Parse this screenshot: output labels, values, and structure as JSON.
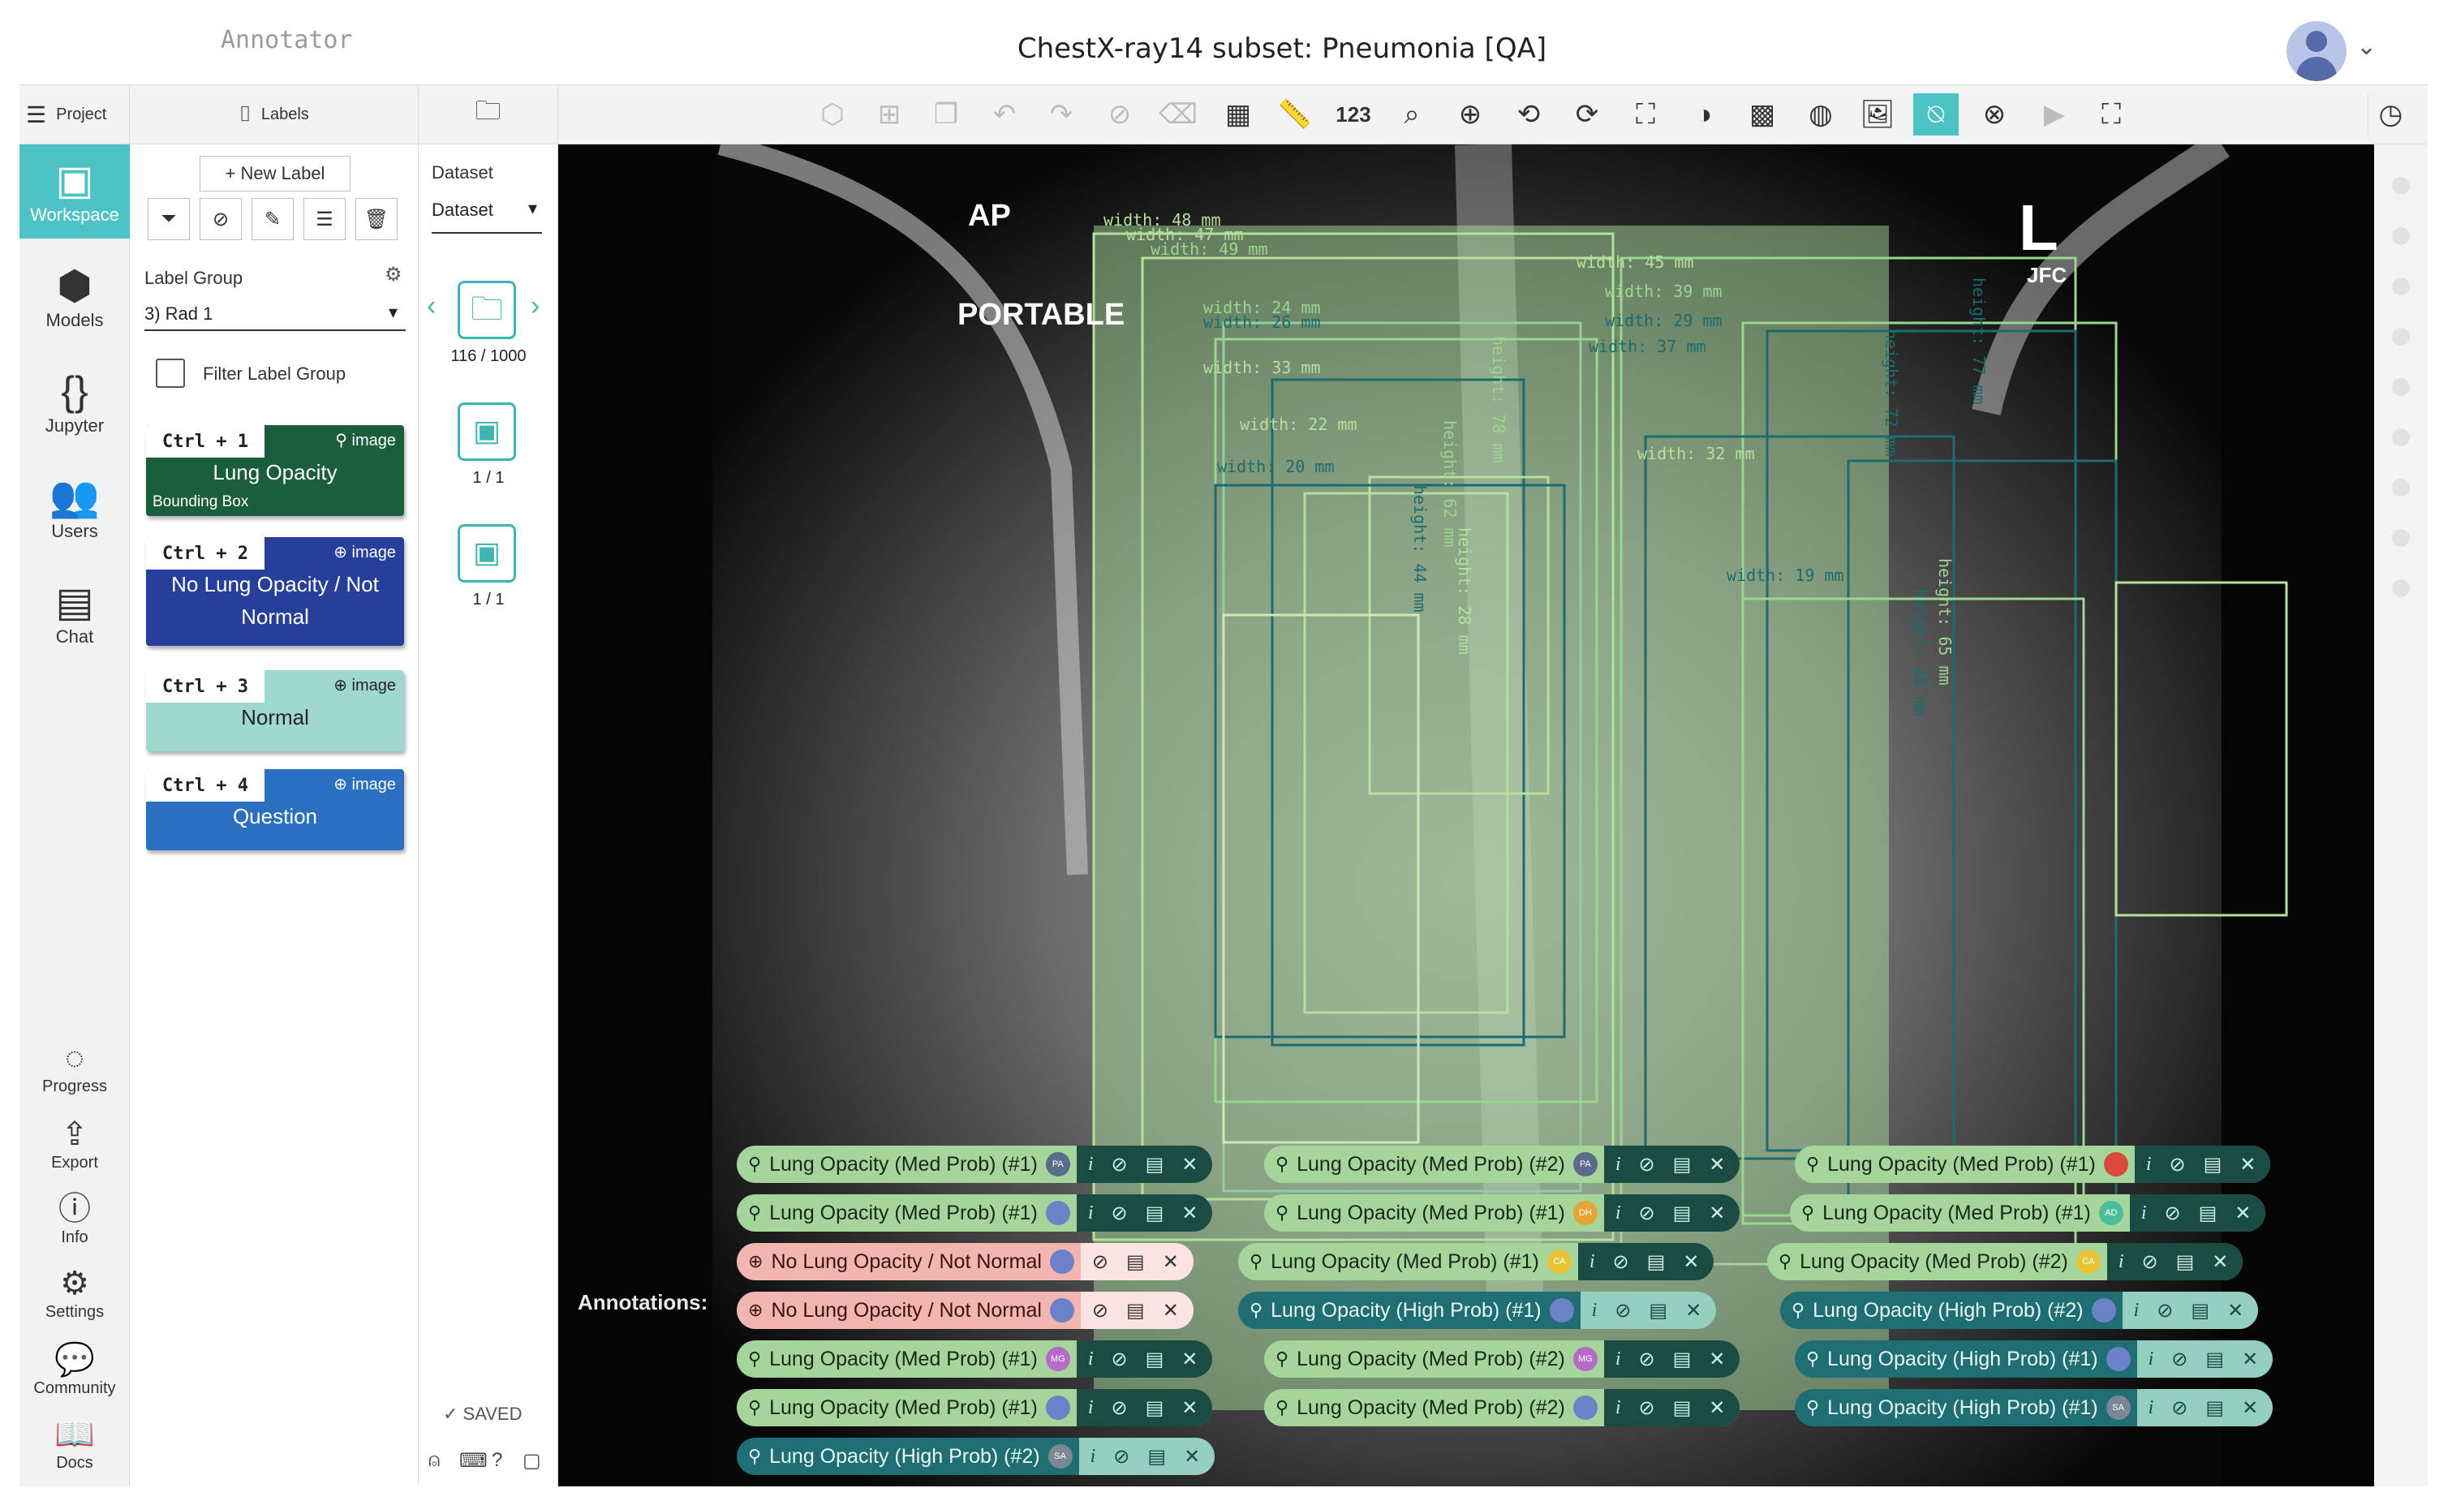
{
  "app": {
    "name": "Annotator",
    "title": "ChestX-ray14 subset: Pneumonia [QA]"
  },
  "toolbar": {
    "project_label": "Project",
    "labels_label": "Labels",
    "zoom_text": "123"
  },
  "nav": {
    "items": [
      {
        "label": "Workspace",
        "icon": "image-icon"
      },
      {
        "label": "Models",
        "icon": "cube-icon"
      },
      {
        "label": "Jupyter",
        "icon": "braces-icon"
      },
      {
        "label": "Users",
        "icon": "users-icon"
      },
      {
        "label": "Chat",
        "icon": "chat-icon"
      }
    ],
    "bottom": [
      {
        "label": "Progress",
        "icon": "progress-icon"
      },
      {
        "label": "Export",
        "icon": "export-icon"
      },
      {
        "label": "Info",
        "icon": "info-icon"
      },
      {
        "label": "Settings",
        "icon": "gear-icon"
      },
      {
        "label": "Community",
        "icon": "community-icon"
      },
      {
        "label": "Docs",
        "icon": "book-icon"
      }
    ]
  },
  "labels_panel": {
    "new_label": "+ New Label",
    "group_heading": "Label Group",
    "group_value": "3) Rad 1",
    "filter_label": "Filter Label Group",
    "cards": [
      {
        "key": "Ctrl + 1",
        "type": "image",
        "name": "Lung Opacity",
        "sub": "Bounding Box",
        "color": "#1b5e3c"
      },
      {
        "key": "Ctrl + 2",
        "type": "image",
        "name": "No Lung Opacity / Not Normal",
        "sub": "",
        "color": "#273f9b"
      },
      {
        "key": "Ctrl + 3",
        "type": "image",
        "name": "Normal",
        "sub": "",
        "color": "#9fd8cf"
      },
      {
        "key": "Ctrl + 4",
        "type": "image",
        "name": "Question",
        "sub": "",
        "color": "#2a6fc0"
      }
    ]
  },
  "dataset_panel": {
    "heading": "Dataset",
    "select_value": "Dataset",
    "counters": [
      "116 / 1000",
      "1 / 1",
      "1 / 1"
    ],
    "saved": "✓ SAVED"
  },
  "image": {
    "marker_ap": "AP",
    "marker_portable": "PORTABLE",
    "marker_l": "L",
    "marker_jfc": "JFC",
    "measure_labels": [
      "width: 48 mm",
      "width: 47 mm",
      "width: 49 mm",
      "width: 24 mm",
      "width: 26 mm",
      "width: 33 mm",
      "width: 22 mm",
      "width: 20 mm",
      "width: 45 mm",
      "width: 39 mm",
      "width: 29 mm",
      "width: 37 mm",
      "width: 32 mm",
      "width: 19 mm",
      "height: 44 mm",
      "height: 62 mm",
      "height: 28 mm",
      "height: 78 mm",
      "height: 72 mm",
      "height: 26 mm",
      "height: 77 mm",
      "height: 65 mm"
    ]
  },
  "annotations": {
    "heading": "Annotations:",
    "chips": [
      {
        "text": "Lung Opacity (Med Prob) (#1)",
        "kind": "med",
        "avatar": "PA",
        "av_color": "#5b6b8c"
      },
      {
        "text": "Lung Opacity (Med Prob) (#2)",
        "kind": "med",
        "avatar": "PA",
        "av_color": "#5b6b8c"
      },
      {
        "text": "Lung Opacity (Med Prob) (#1)",
        "kind": "med",
        "avatar": "",
        "av_color": "#d84a3a"
      },
      {
        "text": "Lung Opacity (Med Prob) (#1)",
        "kind": "med",
        "avatar": "",
        "av_color": "#6b82c9"
      },
      {
        "text": "Lung Opacity (Med Prob) (#1)",
        "kind": "med",
        "avatar": "DH",
        "av_color": "#e5a437"
      },
      {
        "text": "Lung Opacity (Med Prob) (#1)",
        "kind": "med",
        "avatar": "AD",
        "av_color": "#4cbf9a"
      },
      {
        "text": "No Lung Opacity / Not Normal",
        "kind": "nolung",
        "avatar": "",
        "av_color": "#6b82c9"
      },
      {
        "text": "Lung Opacity (Med Prob) (#1)",
        "kind": "med",
        "avatar": "CA",
        "av_color": "#e5c437"
      },
      {
        "text": "Lung Opacity (Med Prob) (#2)",
        "kind": "med",
        "avatar": "CA",
        "av_color": "#e5c437"
      },
      {
        "text": "No Lung Opacity / Not Normal",
        "kind": "nolung",
        "avatar": "",
        "av_color": "#6b82c9"
      },
      {
        "text": "Lung Opacity (High Prob) (#1)",
        "kind": "high",
        "avatar": "",
        "av_color": "#6b82c9"
      },
      {
        "text": "Lung Opacity (High Prob) (#2)",
        "kind": "high",
        "avatar": "",
        "av_color": "#6b82c9"
      },
      {
        "text": "Lung Opacity (Med Prob) (#1)",
        "kind": "med",
        "avatar": "MG",
        "av_color": "#b66bc9"
      },
      {
        "text": "Lung Opacity (Med Prob) (#2)",
        "kind": "med",
        "avatar": "MG",
        "av_color": "#b66bc9"
      },
      {
        "text": "Lung Opacity (High Prob) (#1)",
        "kind": "high",
        "avatar": "",
        "av_color": "#6b82c9"
      },
      {
        "text": "Lung Opacity (Med Prob) (#1)",
        "kind": "med",
        "avatar": "",
        "av_color": "#6b82c9"
      },
      {
        "text": "Lung Opacity (Med Prob) (#2)",
        "kind": "med",
        "avatar": "",
        "av_color": "#6b82c9"
      },
      {
        "text": "Lung Opacity (High Prob) (#1)",
        "kind": "high",
        "avatar": "SA",
        "av_color": "#7c8796"
      },
      {
        "text": "Lung Opacity (High Prob) (#2)",
        "kind": "high",
        "avatar": "SA",
        "av_color": "#7c8796"
      }
    ]
  },
  "colors": {
    "accent": "#4cc2c4",
    "box_med": "#a6d59c",
    "box_high": "#1e6e74"
  }
}
